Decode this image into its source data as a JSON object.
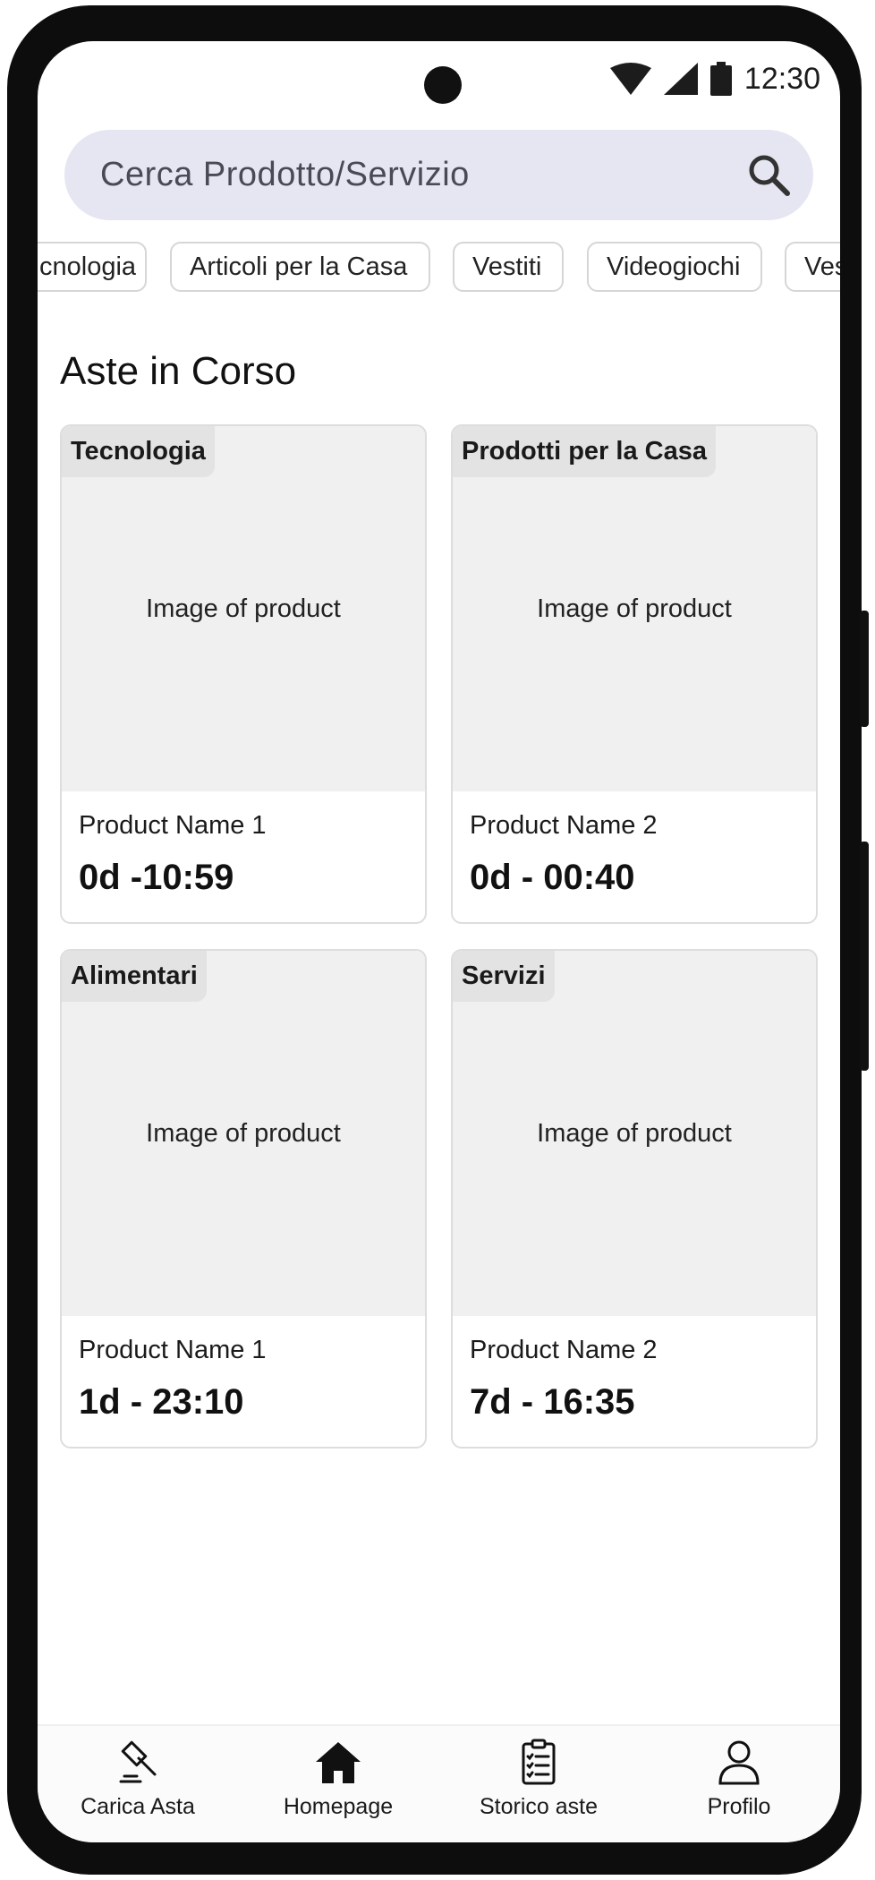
{
  "status_bar": {
    "time": "12:30"
  },
  "search": {
    "placeholder": "Cerca Prodotto/Servizio"
  },
  "categories": [
    "cnologia",
    "Articoli per la Casa",
    "Vestiti",
    "Videogiochi",
    "Ves"
  ],
  "section_title": "Aste in Corso",
  "cards": [
    {
      "tag": "Tecnologia",
      "image_label": "Image of product",
      "name": "Product Name 1",
      "time": "0d -10:59"
    },
    {
      "tag": "Prodotti per la Casa",
      "image_label": "Image of product",
      "name": "Product Name 2",
      "time": "0d - 00:40"
    },
    {
      "tag": "Alimentari",
      "image_label": "Image of product",
      "name": "Product Name 1",
      "time": "1d - 23:10"
    },
    {
      "tag": "Servizi",
      "image_label": "Image of product",
      "name": "Product Name 2",
      "time": "7d - 16:35"
    }
  ],
  "bottom_nav": [
    {
      "label": "Carica Asta",
      "icon": "gavel-icon"
    },
    {
      "label": "Homepage",
      "icon": "home-icon"
    },
    {
      "label": "Storico aste",
      "icon": "clipboard-list-icon"
    },
    {
      "label": "Profilo",
      "icon": "user-icon"
    }
  ],
  "colors": {
    "search_bg": "#e6e6f3",
    "card_image_bg": "#f0f0f0",
    "tag_bg": "#e3e3e3",
    "chip_border": "#d6d6d6"
  }
}
